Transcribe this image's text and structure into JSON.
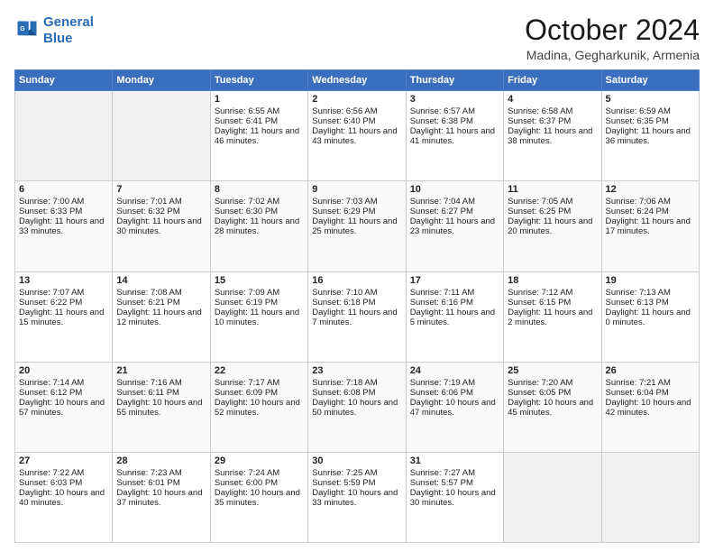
{
  "header": {
    "logo_line1": "General",
    "logo_line2": "Blue",
    "month": "October 2024",
    "location": "Madina, Gegharkunik, Armenia"
  },
  "days_of_week": [
    "Sunday",
    "Monday",
    "Tuesday",
    "Wednesday",
    "Thursday",
    "Friday",
    "Saturday"
  ],
  "weeks": [
    [
      {
        "day": "",
        "info": ""
      },
      {
        "day": "",
        "info": ""
      },
      {
        "day": "1",
        "info": "Sunrise: 6:55 AM\nSunset: 6:41 PM\nDaylight: 11 hours and 46 minutes."
      },
      {
        "day": "2",
        "info": "Sunrise: 6:56 AM\nSunset: 6:40 PM\nDaylight: 11 hours and 43 minutes."
      },
      {
        "day": "3",
        "info": "Sunrise: 6:57 AM\nSunset: 6:38 PM\nDaylight: 11 hours and 41 minutes."
      },
      {
        "day": "4",
        "info": "Sunrise: 6:58 AM\nSunset: 6:37 PM\nDaylight: 11 hours and 38 minutes."
      },
      {
        "day": "5",
        "info": "Sunrise: 6:59 AM\nSunset: 6:35 PM\nDaylight: 11 hours and 36 minutes."
      }
    ],
    [
      {
        "day": "6",
        "info": "Sunrise: 7:00 AM\nSunset: 6:33 PM\nDaylight: 11 hours and 33 minutes."
      },
      {
        "day": "7",
        "info": "Sunrise: 7:01 AM\nSunset: 6:32 PM\nDaylight: 11 hours and 30 minutes."
      },
      {
        "day": "8",
        "info": "Sunrise: 7:02 AM\nSunset: 6:30 PM\nDaylight: 11 hours and 28 minutes."
      },
      {
        "day": "9",
        "info": "Sunrise: 7:03 AM\nSunset: 6:29 PM\nDaylight: 11 hours and 25 minutes."
      },
      {
        "day": "10",
        "info": "Sunrise: 7:04 AM\nSunset: 6:27 PM\nDaylight: 11 hours and 23 minutes."
      },
      {
        "day": "11",
        "info": "Sunrise: 7:05 AM\nSunset: 6:25 PM\nDaylight: 11 hours and 20 minutes."
      },
      {
        "day": "12",
        "info": "Sunrise: 7:06 AM\nSunset: 6:24 PM\nDaylight: 11 hours and 17 minutes."
      }
    ],
    [
      {
        "day": "13",
        "info": "Sunrise: 7:07 AM\nSunset: 6:22 PM\nDaylight: 11 hours and 15 minutes."
      },
      {
        "day": "14",
        "info": "Sunrise: 7:08 AM\nSunset: 6:21 PM\nDaylight: 11 hours and 12 minutes."
      },
      {
        "day": "15",
        "info": "Sunrise: 7:09 AM\nSunset: 6:19 PM\nDaylight: 11 hours and 10 minutes."
      },
      {
        "day": "16",
        "info": "Sunrise: 7:10 AM\nSunset: 6:18 PM\nDaylight: 11 hours and 7 minutes."
      },
      {
        "day": "17",
        "info": "Sunrise: 7:11 AM\nSunset: 6:16 PM\nDaylight: 11 hours and 5 minutes."
      },
      {
        "day": "18",
        "info": "Sunrise: 7:12 AM\nSunset: 6:15 PM\nDaylight: 11 hours and 2 minutes."
      },
      {
        "day": "19",
        "info": "Sunrise: 7:13 AM\nSunset: 6:13 PM\nDaylight: 11 hours and 0 minutes."
      }
    ],
    [
      {
        "day": "20",
        "info": "Sunrise: 7:14 AM\nSunset: 6:12 PM\nDaylight: 10 hours and 57 minutes."
      },
      {
        "day": "21",
        "info": "Sunrise: 7:16 AM\nSunset: 6:11 PM\nDaylight: 10 hours and 55 minutes."
      },
      {
        "day": "22",
        "info": "Sunrise: 7:17 AM\nSunset: 6:09 PM\nDaylight: 10 hours and 52 minutes."
      },
      {
        "day": "23",
        "info": "Sunrise: 7:18 AM\nSunset: 6:08 PM\nDaylight: 10 hours and 50 minutes."
      },
      {
        "day": "24",
        "info": "Sunrise: 7:19 AM\nSunset: 6:06 PM\nDaylight: 10 hours and 47 minutes."
      },
      {
        "day": "25",
        "info": "Sunrise: 7:20 AM\nSunset: 6:05 PM\nDaylight: 10 hours and 45 minutes."
      },
      {
        "day": "26",
        "info": "Sunrise: 7:21 AM\nSunset: 6:04 PM\nDaylight: 10 hours and 42 minutes."
      }
    ],
    [
      {
        "day": "27",
        "info": "Sunrise: 7:22 AM\nSunset: 6:03 PM\nDaylight: 10 hours and 40 minutes."
      },
      {
        "day": "28",
        "info": "Sunrise: 7:23 AM\nSunset: 6:01 PM\nDaylight: 10 hours and 37 minutes."
      },
      {
        "day": "29",
        "info": "Sunrise: 7:24 AM\nSunset: 6:00 PM\nDaylight: 10 hours and 35 minutes."
      },
      {
        "day": "30",
        "info": "Sunrise: 7:25 AM\nSunset: 5:59 PM\nDaylight: 10 hours and 33 minutes."
      },
      {
        "day": "31",
        "info": "Sunrise: 7:27 AM\nSunset: 5:57 PM\nDaylight: 10 hours and 30 minutes."
      },
      {
        "day": "",
        "info": ""
      },
      {
        "day": "",
        "info": ""
      }
    ]
  ]
}
